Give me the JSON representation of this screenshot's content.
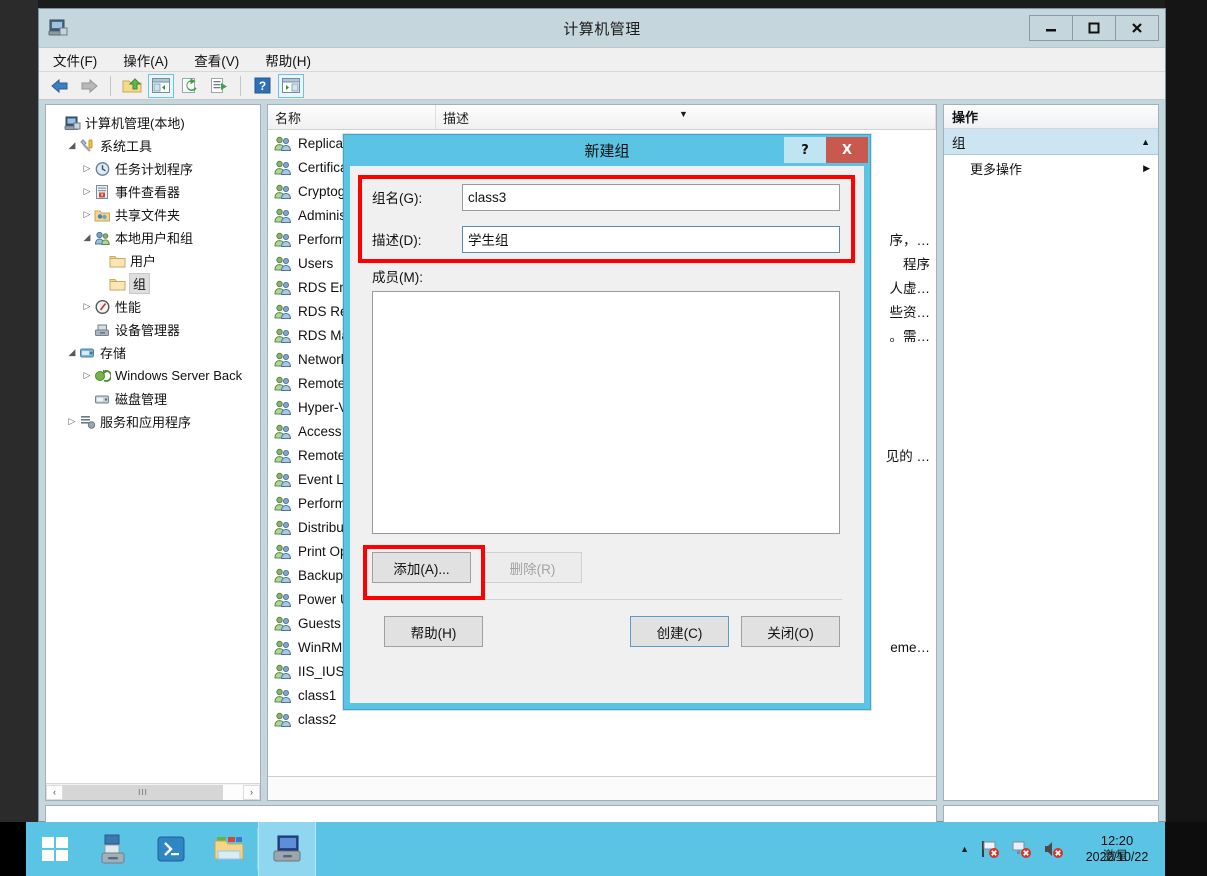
{
  "window": {
    "title": "计算机管理",
    "icon": "computer-management-icon",
    "controls": {
      "minimize": "—",
      "maximize": "❐",
      "close": "✕"
    }
  },
  "menubar": {
    "items": [
      {
        "label": "文件(F)",
        "name": "menu-file"
      },
      {
        "label": "操作(A)",
        "name": "menu-action"
      },
      {
        "label": "查看(V)",
        "name": "menu-view"
      },
      {
        "label": "帮助(H)",
        "name": "menu-help"
      }
    ]
  },
  "toolbar": {
    "items": [
      {
        "name": "back-icon",
        "glyph": "⬅"
      },
      {
        "name": "forward-icon",
        "glyph": "➡"
      },
      {
        "name": "up-folder-icon",
        "glyph": "📂"
      },
      {
        "name": "show-tree-icon",
        "glyph": "▣"
      },
      {
        "name": "refresh-icon",
        "glyph": "⟳"
      },
      {
        "name": "export-list-icon",
        "glyph": "⇥"
      },
      {
        "name": "help-icon",
        "glyph": "?"
      },
      {
        "name": "show-action-pane-icon",
        "glyph": "▤"
      }
    ]
  },
  "tree": {
    "items": [
      {
        "label": "计算机管理(本地)",
        "depth": 0,
        "expander": "",
        "icon": "computer-icon",
        "selected": false
      },
      {
        "label": "系统工具",
        "depth": 1,
        "expander": "◢",
        "icon": "system-tools-icon",
        "selected": false
      },
      {
        "label": "任务计划程序",
        "depth": 2,
        "expander": "▷",
        "icon": "task-scheduler-icon",
        "selected": false
      },
      {
        "label": "事件查看器",
        "depth": 2,
        "expander": "▷",
        "icon": "event-viewer-icon",
        "selected": false
      },
      {
        "label": "共享文件夹",
        "depth": 2,
        "expander": "▷",
        "icon": "shared-folders-icon",
        "selected": false
      },
      {
        "label": "本地用户和组",
        "depth": 2,
        "expander": "◢",
        "icon": "local-users-groups-icon",
        "selected": false
      },
      {
        "label": "用户",
        "depth": 3,
        "expander": "",
        "icon": "folder-icon",
        "selected": false
      },
      {
        "label": "组",
        "depth": 3,
        "expander": "",
        "icon": "folder-icon",
        "selected": true
      },
      {
        "label": "性能",
        "depth": 2,
        "expander": "▷",
        "icon": "performance-icon",
        "selected": false
      },
      {
        "label": "设备管理器",
        "depth": 2,
        "expander": "",
        "icon": "device-manager-icon",
        "selected": false
      },
      {
        "label": "存储",
        "depth": 1,
        "expander": "◢",
        "icon": "storage-icon",
        "selected": false
      },
      {
        "label": "Windows Server Back",
        "depth": 2,
        "expander": "▷",
        "icon": "windows-backup-icon",
        "selected": false
      },
      {
        "label": "磁盘管理",
        "depth": 2,
        "expander": "",
        "icon": "disk-management-icon",
        "selected": false
      },
      {
        "label": "服务和应用程序",
        "depth": 1,
        "expander": "▷",
        "icon": "services-apps-icon",
        "selected": false
      }
    ],
    "hscroll": {
      "left_arrow": "‹",
      "right_arrow": "›",
      "thumb_grip": "III"
    }
  },
  "list": {
    "columns": [
      {
        "label": "名称",
        "name": "column-name"
      },
      {
        "label": "描述",
        "name": "column-description"
      }
    ],
    "sort_marker": "▼",
    "rows": [
      {
        "name": "Replicat",
        "desc": ""
      },
      {
        "name": "Certifica",
        "desc": ""
      },
      {
        "name": "Cryptog",
        "desc": ""
      },
      {
        "name": "Administ",
        "desc": ""
      },
      {
        "name": "Perform",
        "desc": "序，…"
      },
      {
        "name": "Users",
        "desc": "程序"
      },
      {
        "name": "RDS End",
        "desc": "人虚…"
      },
      {
        "name": "RDS Rem",
        "desc": "些资…"
      },
      {
        "name": "RDS Ma",
        "desc": "。需…"
      },
      {
        "name": "Network",
        "desc": ""
      },
      {
        "name": "Remote",
        "desc": ""
      },
      {
        "name": "Hyper-V",
        "desc": ""
      },
      {
        "name": "Access C",
        "desc": ""
      },
      {
        "name": "Remote",
        "desc": "见的 …"
      },
      {
        "name": "Event Lo",
        "desc": ""
      },
      {
        "name": "Perform",
        "desc": ""
      },
      {
        "name": "Distribut",
        "desc": ""
      },
      {
        "name": "Print Op",
        "desc": ""
      },
      {
        "name": "Backup",
        "desc": ""
      },
      {
        "name": "Power U",
        "desc": ""
      },
      {
        "name": "Guests",
        "desc": ""
      },
      {
        "name": "WinRMR",
        "desc": "eme…"
      },
      {
        "name": "IIS_IUSR",
        "desc": ""
      },
      {
        "name": "class1",
        "desc": ""
      },
      {
        "name": "class2",
        "desc": ""
      }
    ]
  },
  "actions": {
    "title": "操作",
    "group": {
      "label": "组",
      "caret": "▲"
    },
    "items": [
      {
        "label": "更多操作",
        "submark": "▶"
      }
    ]
  },
  "dialog": {
    "title": "新建组",
    "help_button": "?",
    "close_button": "X",
    "fields": [
      {
        "label": "组名(G):",
        "value": "class3",
        "name": "group-name-input",
        "border": "gray"
      },
      {
        "label": "描述(D):",
        "value": "学生组",
        "name": "group-description-input",
        "border": "blue"
      }
    ],
    "members_label": "成员(M):",
    "members": [],
    "member_buttons": [
      {
        "label": "添加(A)...",
        "name": "add-member-button",
        "disabled": false
      },
      {
        "label": "删除(R)",
        "name": "remove-member-button",
        "disabled": true
      }
    ],
    "footer_buttons": [
      {
        "label": "帮助(H)",
        "name": "dialog-help-button",
        "primary": false
      },
      {
        "label": "创建(C)",
        "name": "dialog-create-button",
        "primary": true
      },
      {
        "label": "关闭(O)",
        "name": "dialog-close-button",
        "primary": false
      }
    ]
  },
  "annotations": {
    "accent_color": "#ff0000",
    "boxes": [
      "group-fields-highlight",
      "add-member-highlight"
    ]
  },
  "taskbar": {
    "buttons": [
      {
        "name": "start-button",
        "glyph": "start"
      },
      {
        "name": "server-manager-task",
        "glyph": "server-manager"
      },
      {
        "name": "powershell-task",
        "glyph": "powershell"
      },
      {
        "name": "file-explorer-task",
        "glyph": "explorer"
      },
      {
        "name": "computer-management-task",
        "glyph": "computer-management",
        "active": true
      }
    ],
    "tray": {
      "expand": "▲",
      "icons": [
        "network-flag-error-icon",
        "network-error-icon",
        "volume-mute-icon"
      ],
      "clock": {
        "time": "12:20",
        "date": "2022/10/22",
        "watermark": "激星"
      }
    }
  },
  "colors": {
    "window_chrome": "#c5d6dd",
    "dialog_titlebar": "#5bc4e5",
    "taskbar": "#5bc4e5",
    "accent_red": "#ff0000",
    "selection_blue": "#cde4f2",
    "close_red": "#c9584f"
  }
}
